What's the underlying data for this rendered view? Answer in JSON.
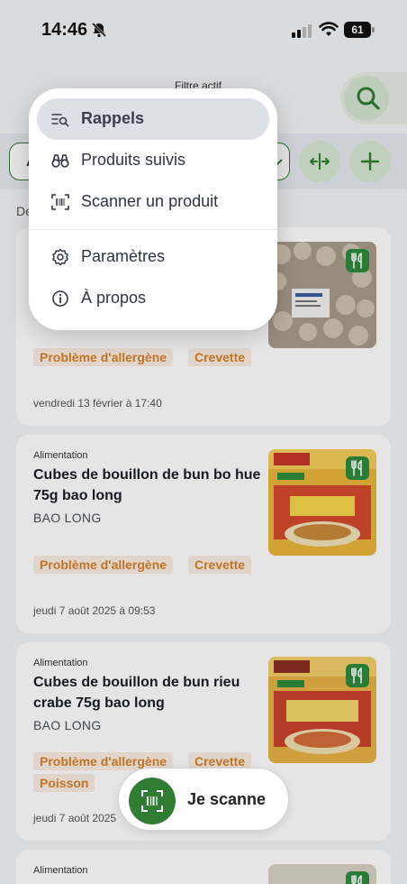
{
  "status_bar": {
    "time": "14:46",
    "battery": "61"
  },
  "header": {
    "filter_label": "Filtre actif",
    "filter_value_initial": "A",
    "section_initial": "De"
  },
  "menu": {
    "items": [
      {
        "label": "Rappels",
        "icon": "list-search-icon",
        "active": true
      },
      {
        "label": "Produits suivis",
        "icon": "binoculars-icon"
      },
      {
        "label": "Scanner un produit",
        "icon": "barcode-scan-icon"
      },
      {
        "label": "Paramètres",
        "icon": "gear-icon"
      },
      {
        "label": "À propos",
        "icon": "info-icon"
      }
    ]
  },
  "cards": [
    {
      "category": "",
      "title": "",
      "brand": "",
      "tags": [
        "Problème d'allergène",
        "Crevette"
      ],
      "date": "vendredi 13 février à 17:40"
    },
    {
      "category": "Alimentation",
      "title": "Cubes de bouillon de bun bo hue 75g bao long",
      "brand": "BAO LONG",
      "tags": [
        "Problème d'allergène",
        "Crevette"
      ],
      "date": "jeudi 7 août 2025 à 09:53"
    },
    {
      "category": "Alimentation",
      "title": "Cubes de bouillon de bun rieu crabe 75g bao long",
      "brand": "BAO LONG",
      "tags": [
        "Problème d'allergène",
        "Crevette",
        "Poisson"
      ],
      "date": "jeudi 7 août 2025"
    },
    {
      "category": "Alimentation"
    }
  ],
  "scan_button": {
    "label": "Je scanne"
  },
  "colors": {
    "accent": "#2e7d32",
    "tag_text": "#d9822b",
    "tag_bg": "#fbeee3"
  }
}
